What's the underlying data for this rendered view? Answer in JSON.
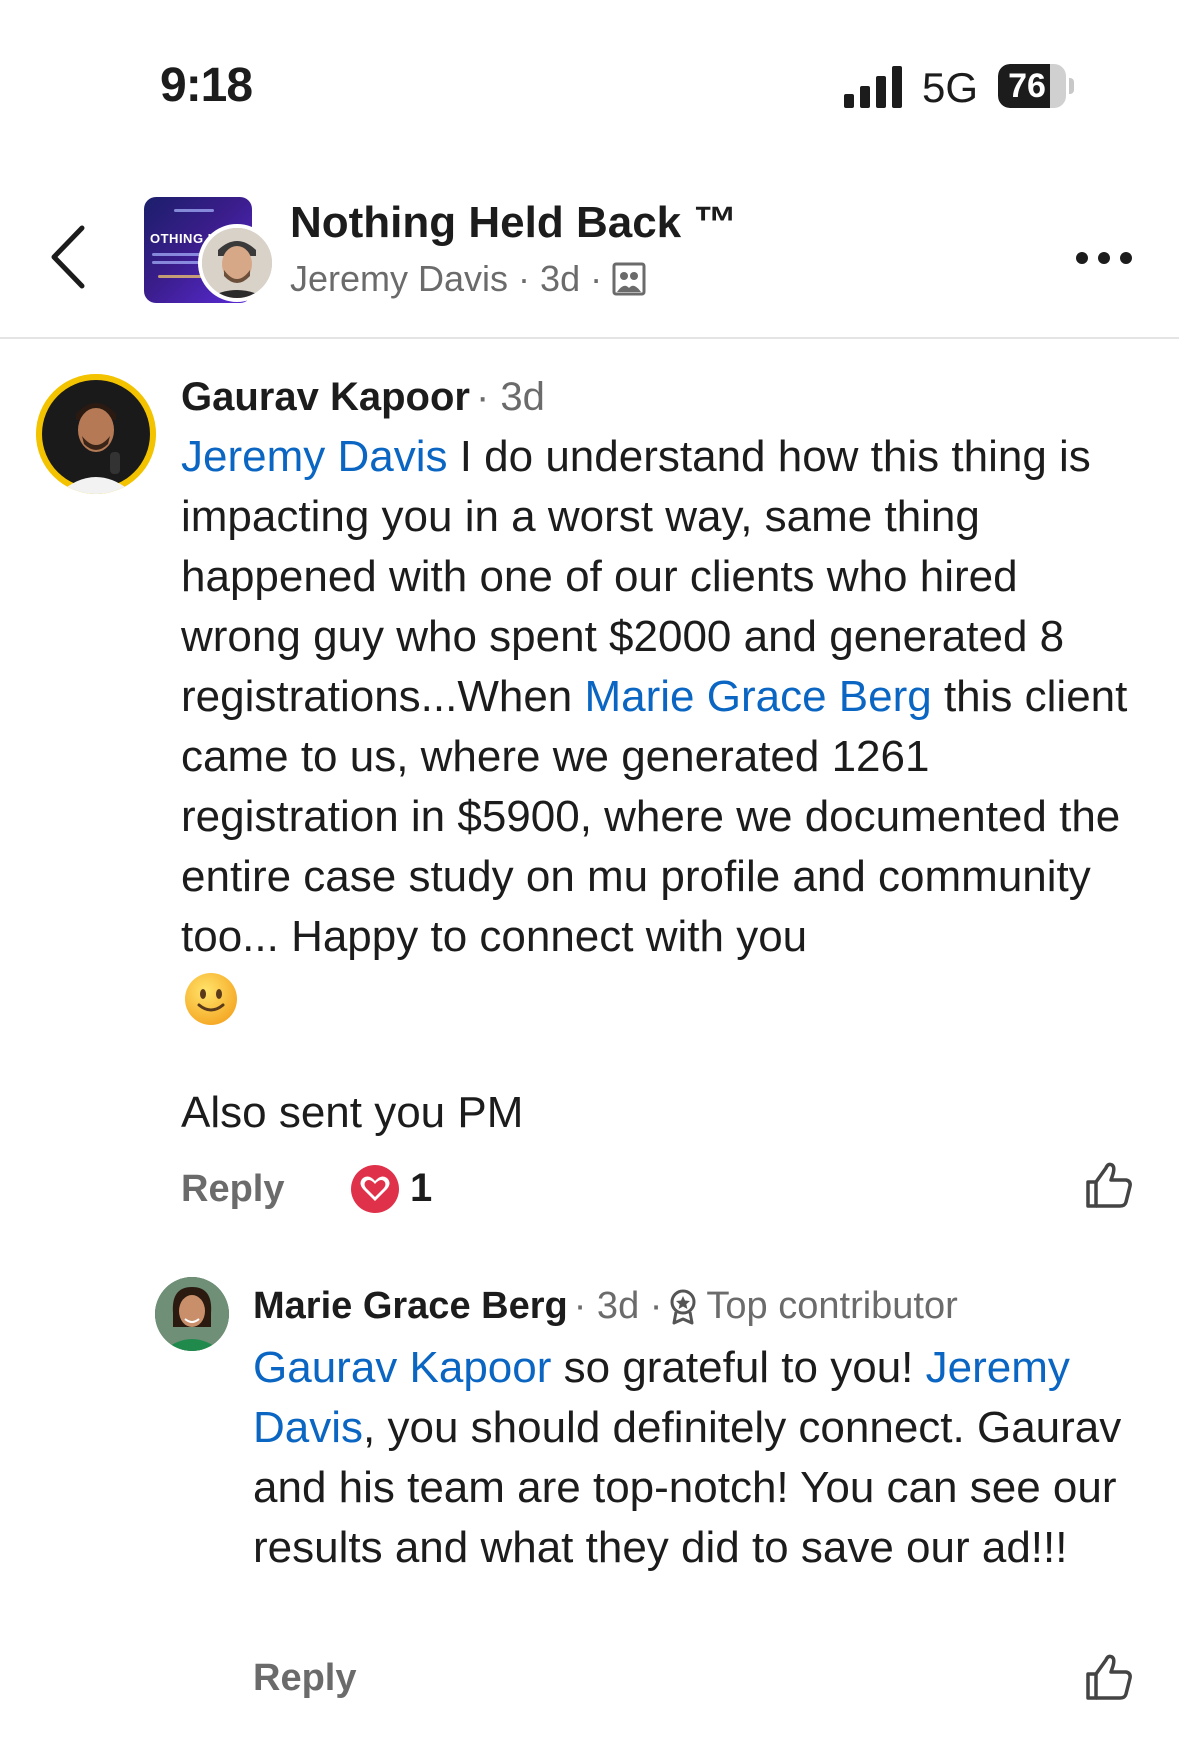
{
  "status_bar": {
    "time": "9:18",
    "network": "5G",
    "battery": "76",
    "battery_level": 0.76
  },
  "header": {
    "group_name": "Nothing Held Back ™",
    "author": "Jeremy Davis",
    "time": "3d",
    "thumb_text": "OTHING HE",
    "separator": "·"
  },
  "comments": [
    {
      "author": "Gaurav Kapoor",
      "time": "· 3d",
      "segments": [
        {
          "text": "Jeremy Davis",
          "mention": true
        },
        {
          "text": " I do understand how this thing is impacting you in a worst way, same thing happened with one of our clients who hired wrong guy who spent $2000 and generated 8 registrations...When ",
          "mention": false
        },
        {
          "text": "Marie Grace Berg",
          "mention": true
        },
        {
          "text": " this client came to us, where we generated 1261 registration in $5900, where we documented the entire case study on mu profile and community too... Happy to connect with you",
          "mention": false
        }
      ],
      "extra": "Also sent you PM",
      "reply_label": "Reply",
      "reaction_count": "1"
    },
    {
      "author": "Marie Grace Berg",
      "time": "· 3d ·",
      "badge": "Top contributor",
      "segments": [
        {
          "text": "Gaurav Kapoor",
          "mention": true
        },
        {
          "text": " so grateful to you! ",
          "mention": false
        },
        {
          "text": "Jeremy Davis",
          "mention": true
        },
        {
          "text": ", you should definitely connect. Gaurav and his team are top-notch! You can see our results and what they did to save our ad!!!",
          "mention": false
        }
      ],
      "reply_label": "Reply"
    }
  ],
  "colors": {
    "mention": "#0a66c2",
    "reaction_heart": "#e0314b",
    "meta": "#6b6b6b"
  },
  "icons": [
    "back-chevron-icon",
    "more-icon",
    "group-visibility-icon",
    "heart-icon",
    "like-icon",
    "top-contributor-icon",
    "smile-emoji-icon"
  ]
}
